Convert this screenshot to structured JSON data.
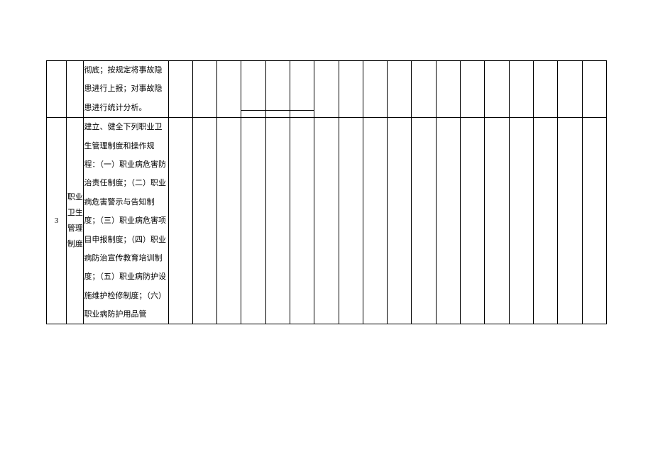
{
  "rows": [
    {
      "num": "",
      "category": "",
      "desc": "彻底；按规定将事故隐患进行上报；对事故隐患进行统计分析。"
    },
    {
      "num": "3",
      "category": "职业卫生管理制度",
      "desc": "建立、健全下列职业卫生管理制度和操作规程：（一）职业病危害防治责任制度；（二）职业病危害警示与告知制度；（三）职业病危害项目申报制度；（四）职业病防治宣传教育培训制度；（五）职业病防护设施维护检修制度；（六）职业病防护用品管"
    }
  ]
}
